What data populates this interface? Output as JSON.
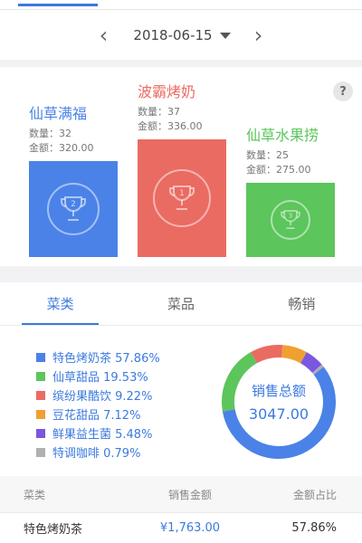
{
  "date_nav": {
    "prev_icon": "‹",
    "date": "2018-06-15",
    "next_icon": "›"
  },
  "podium": {
    "help_icon": "?",
    "products": [
      {
        "rank": "2",
        "name": "仙草满福",
        "qty_label": "数量：",
        "qty": "32",
        "amount_label": "金额：",
        "amount": "320.00",
        "color": "#4a82e8"
      },
      {
        "rank": "1",
        "name": "波霸烤奶",
        "qty_label": "数量：",
        "qty": "37",
        "amount_label": "金额：",
        "amount": "336.00",
        "color": "#ea6b62"
      },
      {
        "rank": "3",
        "name": "仙草水果捞",
        "qty_label": "数量：",
        "qty": "25",
        "amount_label": "金额：",
        "amount": "275.00",
        "color": "#5cc55c"
      }
    ]
  },
  "tabs": [
    {
      "label": "菜类",
      "active": true
    },
    {
      "label": "菜品",
      "active": false
    },
    {
      "label": "畅销",
      "active": false
    }
  ],
  "breakdown": {
    "center_title": "销售总额",
    "center_value": "3047.00",
    "items": [
      {
        "label": "特色烤奶茶 57.86%",
        "pct": 57.86,
        "color": "#4a82e8"
      },
      {
        "label": "仙草甜品 19.53%",
        "pct": 19.53,
        "color": "#5cc55c"
      },
      {
        "label": "缤纷果酷饮 9.22%",
        "pct": 9.22,
        "color": "#ea6b62"
      },
      {
        "label": "豆花甜品 7.12%",
        "pct": 7.12,
        "color": "#f0a030"
      },
      {
        "label": "鲜果益生菌 5.48%",
        "pct": 5.48,
        "color": "#7b56e0"
      },
      {
        "label": "特调咖啡 0.79%",
        "pct": 0.79,
        "color": "#b0b0b0"
      }
    ]
  },
  "table": {
    "headers": [
      "菜类",
      "销售金额",
      "金额占比"
    ],
    "rows": [
      [
        "特色烤奶茶",
        "¥1,763.00",
        "57.86%"
      ]
    ]
  }
}
